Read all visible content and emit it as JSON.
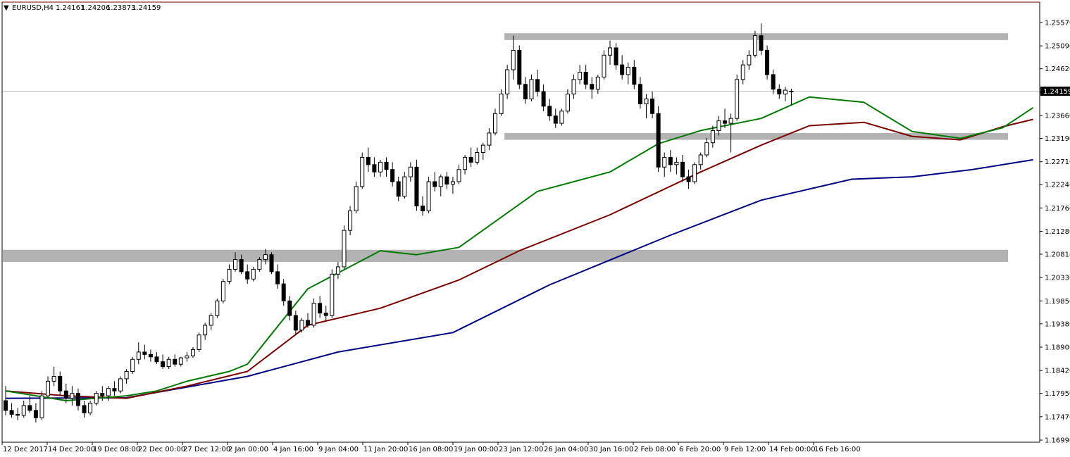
{
  "header": {
    "menu_glyph": "▼",
    "symbol_tf": "EURUSD,H4",
    "ohlc": [
      "1.24161",
      "1.24206",
      "1.23873",
      "1.24159"
    ]
  },
  "colors": {
    "background": "#ffffff",
    "candle": "#000000",
    "ma_fast": "#007a00",
    "ma_mid": "#7a0000",
    "ma_slow": "#000080",
    "zone": "#b3b3b3",
    "price_line": "#c0c0c0",
    "frame_top": "#7a0000"
  },
  "chart_data": {
    "type": "candlestick",
    "instrument": "EURUSD",
    "timeframe": "H4",
    "last_price": "1.24159",
    "y_ticks": [
      "1.25570",
      "1.25090",
      "1.24620",
      "1.24140",
      "1.23660",
      "1.23190",
      "1.22710",
      "1.22240",
      "1.21760",
      "1.21280",
      "1.20810",
      "1.20330",
      "1.19850",
      "1.19380",
      "1.18900",
      "1.18420",
      "1.17950",
      "1.17470",
      "1.16990"
    ],
    "ylim": [
      1.1699,
      1.2557
    ],
    "x_ticks": [
      "12 Dec 2017",
      "14 Dec 20:00",
      "19 Dec 08:00",
      "22 Dec 00:00",
      "27 Dec 12:00",
      "2 Jan 00:00",
      "4 Jan 16:00",
      "9 Jan 04:00",
      "11 Jan 20:00",
      "16 Jan 08:00",
      "19 Jan 00:00",
      "23 Jan 12:00",
      "26 Jan 04:00",
      "30 Jan 16:00",
      "2 Feb 08:00",
      "6 Feb 20:00",
      "9 Feb 12:00",
      "14 Feb 00:00",
      "16 Feb 16:00"
    ],
    "zones": [
      {
        "low": 1.2521,
        "high": 1.2535,
        "from_index": 83,
        "to_index": 179
      },
      {
        "low": 1.2316,
        "high": 1.233,
        "from_index": 83,
        "to_index": 180
      },
      {
        "low": 1.2065,
        "high": 1.209,
        "from_index": 0,
        "to_index": 205
      }
    ],
    "ma_fast": [
      [
        0,
        1.18
      ],
      [
        10,
        1.178
      ],
      [
        20,
        1.179
      ],
      [
        25,
        1.18
      ],
      [
        30,
        1.182
      ],
      [
        37,
        1.184
      ],
      [
        40,
        1.1855
      ],
      [
        50,
        1.201
      ],
      [
        62,
        1.2088
      ],
      [
        68,
        1.208
      ],
      [
        75,
        1.2095
      ],
      [
        88,
        1.221
      ],
      [
        100,
        1.225
      ],
      [
        108,
        1.2308
      ],
      [
        115,
        1.2335
      ],
      [
        125,
        1.236
      ],
      [
        133,
        1.2404
      ],
      [
        142,
        1.2393
      ],
      [
        150,
        1.2333
      ],
      [
        158,
        1.2319
      ],
      [
        165,
        1.2341
      ],
      [
        170,
        1.2382
      ]
    ],
    "ma_mid": [
      [
        0,
        1.18
      ],
      [
        10,
        1.179
      ],
      [
        20,
        1.1785
      ],
      [
        30,
        1.181
      ],
      [
        40,
        1.184
      ],
      [
        50,
        1.1935
      ],
      [
        62,
        1.197
      ],
      [
        75,
        1.2028
      ],
      [
        85,
        1.2088
      ],
      [
        100,
        1.2162
      ],
      [
        115,
        1.225
      ],
      [
        125,
        1.2305
      ],
      [
        133,
        1.2345
      ],
      [
        142,
        1.2352
      ],
      [
        150,
        1.2323
      ],
      [
        158,
        1.2316
      ],
      [
        165,
        1.2343
      ],
      [
        170,
        1.2358
      ]
    ],
    "ma_slow": [
      [
        0,
        1.1785
      ],
      [
        20,
        1.1786
      ],
      [
        40,
        1.183
      ],
      [
        55,
        1.188
      ],
      [
        74,
        1.192
      ],
      [
        90,
        1.2018
      ],
      [
        110,
        1.212
      ],
      [
        125,
        1.2192
      ],
      [
        140,
        1.2235
      ],
      [
        150,
        1.224
      ],
      [
        160,
        1.2255
      ],
      [
        170,
        1.2275
      ]
    ],
    "candles": [
      [
        1.178,
        1.181,
        1.175,
        1.176
      ],
      [
        1.176,
        1.1775,
        1.1745,
        1.1752
      ],
      [
        1.1752,
        1.1765,
        1.174,
        1.175
      ],
      [
        1.175,
        1.178,
        1.1745,
        1.177
      ],
      [
        1.177,
        1.179,
        1.1755,
        1.176
      ],
      [
        1.176,
        1.1775,
        1.1735,
        1.1745
      ],
      [
        1.1745,
        1.18,
        1.174,
        1.179
      ],
      [
        1.179,
        1.183,
        1.1785,
        1.182
      ],
      [
        1.182,
        1.185,
        1.181,
        1.183
      ],
      [
        1.183,
        1.184,
        1.179,
        1.18
      ],
      [
        1.18,
        1.1815,
        1.1775,
        1.1785
      ],
      [
        1.1785,
        1.181,
        1.177,
        1.1795
      ],
      [
        1.1795,
        1.1805,
        1.176,
        1.177
      ],
      [
        1.177,
        1.178,
        1.1745,
        1.1755
      ],
      [
        1.1755,
        1.178,
        1.175,
        1.1775
      ],
      [
        1.1775,
        1.18,
        1.177,
        1.1795
      ],
      [
        1.1795,
        1.181,
        1.178,
        1.179
      ],
      [
        1.179,
        1.181,
        1.178,
        1.1805
      ],
      [
        1.1805,
        1.182,
        1.179,
        1.18
      ],
      [
        1.18,
        1.183,
        1.1795,
        1.1825
      ],
      [
        1.1825,
        1.1845,
        1.1815,
        1.184
      ],
      [
        1.184,
        1.187,
        1.1835,
        1.1865
      ],
      [
        1.1865,
        1.19,
        1.1855,
        1.188
      ],
      [
        1.188,
        1.1895,
        1.1865,
        1.1875
      ],
      [
        1.1875,
        1.1885,
        1.186,
        1.187
      ],
      [
        1.187,
        1.188,
        1.1855,
        1.186
      ],
      [
        1.186,
        1.1875,
        1.1845,
        1.185
      ],
      [
        1.185,
        1.187,
        1.1845,
        1.1865
      ],
      [
        1.1865,
        1.1875,
        1.185,
        1.1855
      ],
      [
        1.1855,
        1.187,
        1.185,
        1.1868
      ],
      [
        1.1868,
        1.188,
        1.186,
        1.1872
      ],
      [
        1.1872,
        1.189,
        1.1868,
        1.1885
      ],
      [
        1.1885,
        1.192,
        1.188,
        1.1915
      ],
      [
        1.1915,
        1.194,
        1.1905,
        1.1935
      ],
      [
        1.1935,
        1.196,
        1.1925,
        1.1955
      ],
      [
        1.1955,
        1.199,
        1.195,
        1.1985
      ],
      [
        1.1985,
        1.203,
        1.198,
        1.2025
      ],
      [
        1.2025,
        1.206,
        1.202,
        1.205
      ],
      [
        1.205,
        1.2085,
        1.2045,
        1.207
      ],
      [
        1.207,
        1.208,
        1.204,
        1.2045
      ],
      [
        1.2045,
        1.206,
        1.202,
        1.203
      ],
      [
        1.203,
        1.2055,
        1.2025,
        1.205
      ],
      [
        1.205,
        1.2075,
        1.2045,
        1.207
      ],
      [
        1.207,
        1.2092,
        1.206,
        1.208
      ],
      [
        1.208,
        1.2085,
        1.204,
        1.2045
      ],
      [
        1.2045,
        1.206,
        1.201,
        1.202
      ],
      [
        1.202,
        1.203,
        1.1975,
        1.1985
      ],
      [
        1.1985,
        1.1995,
        1.1945,
        1.1955
      ],
      [
        1.1955,
        1.1965,
        1.1915,
        1.1925
      ],
      [
        1.1925,
        1.195,
        1.192,
        1.1945
      ],
      [
        1.1945,
        1.196,
        1.193,
        1.1935
      ],
      [
        1.1935,
        1.199,
        1.193,
        1.198
      ],
      [
        1.198,
        1.1995,
        1.195,
        1.196
      ],
      [
        1.196,
        1.1975,
        1.1945,
        1.1955
      ],
      [
        1.1955,
        1.205,
        1.195,
        1.204
      ],
      [
        1.204,
        1.2065,
        1.203,
        1.2055
      ],
      [
        1.2055,
        1.214,
        1.205,
        1.213
      ],
      [
        1.213,
        1.218,
        1.212,
        1.217
      ],
      [
        1.217,
        1.223,
        1.2165,
        1.222
      ],
      [
        1.222,
        1.229,
        1.2215,
        1.228
      ],
      [
        1.228,
        1.23,
        1.225,
        1.2265
      ],
      [
        1.2265,
        1.228,
        1.224,
        1.225
      ],
      [
        1.225,
        1.2275,
        1.224,
        1.227
      ],
      [
        1.227,
        1.228,
        1.224,
        1.2255
      ],
      [
        1.2255,
        1.227,
        1.222,
        1.223
      ],
      [
        1.223,
        1.224,
        1.219,
        1.22
      ],
      [
        1.22,
        1.225,
        1.2195,
        1.224
      ],
      [
        1.224,
        1.227,
        1.223,
        1.226
      ],
      [
        1.226,
        1.2275,
        1.217,
        1.218
      ],
      [
        1.218,
        1.22,
        1.216,
        1.217
      ],
      [
        1.217,
        1.224,
        1.2165,
        1.223
      ],
      [
        1.223,
        1.225,
        1.221,
        1.222
      ],
      [
        1.222,
        1.2245,
        1.22,
        1.224
      ],
      [
        1.224,
        1.225,
        1.2215,
        1.2225
      ],
      [
        1.2225,
        1.224,
        1.2205,
        1.223
      ],
      [
        1.223,
        1.2265,
        1.2225,
        1.2255
      ],
      [
        1.2255,
        1.2285,
        1.2245,
        1.228
      ],
      [
        1.228,
        1.23,
        1.226,
        1.227
      ],
      [
        1.227,
        1.23,
        1.2265,
        1.229
      ],
      [
        1.229,
        1.231,
        1.2275,
        1.2305
      ],
      [
        1.2305,
        1.234,
        1.2295,
        1.233
      ],
      [
        1.233,
        1.238,
        1.2325,
        1.237
      ],
      [
        1.237,
        1.242,
        1.2365,
        1.241
      ],
      [
        1.241,
        1.247,
        1.24,
        1.246
      ],
      [
        1.246,
        1.253,
        1.244,
        1.25
      ],
      [
        1.25,
        1.251,
        1.242,
        1.243
      ],
      [
        1.243,
        1.2445,
        1.239,
        1.24
      ],
      [
        1.24,
        1.245,
        1.2395,
        1.244
      ],
      [
        1.244,
        1.246,
        1.2405,
        1.2415
      ],
      [
        1.2415,
        1.243,
        1.2375,
        1.2385
      ],
      [
        1.2385,
        1.24,
        1.2355,
        1.2365
      ],
      [
        1.2365,
        1.238,
        1.234,
        1.235
      ],
      [
        1.235,
        1.238,
        1.2345,
        1.2375
      ],
      [
        1.2375,
        1.242,
        1.237,
        1.241
      ],
      [
        1.241,
        1.245,
        1.24,
        1.244
      ],
      [
        1.244,
        1.247,
        1.243,
        1.2455
      ],
      [
        1.2455,
        1.247,
        1.242,
        1.243
      ],
      [
        1.243,
        1.2445,
        1.24,
        1.242
      ],
      [
        1.242,
        1.245,
        1.241,
        1.2445
      ],
      [
        1.2445,
        1.25,
        1.244,
        1.249
      ],
      [
        1.249,
        1.252,
        1.247,
        1.2505
      ],
      [
        1.2505,
        1.2515,
        1.246,
        1.247
      ],
      [
        1.247,
        1.249,
        1.244,
        1.245
      ],
      [
        1.245,
        1.2475,
        1.243,
        1.2465
      ],
      [
        1.2465,
        1.248,
        1.242,
        1.243
      ],
      [
        1.243,
        1.2445,
        1.238,
        1.239
      ],
      [
        1.239,
        1.241,
        1.236,
        1.24
      ],
      [
        1.24,
        1.2415,
        1.236,
        1.237
      ],
      [
        1.237,
        1.2385,
        1.225,
        1.226
      ],
      [
        1.226,
        1.229,
        1.224,
        1.228
      ],
      [
        1.228,
        1.2295,
        1.225,
        1.2265
      ],
      [
        1.2265,
        1.228,
        1.2245,
        1.227
      ],
      [
        1.227,
        1.2285,
        1.223,
        1.224
      ],
      [
        1.224,
        1.2255,
        1.2215,
        1.223
      ],
      [
        1.223,
        1.227,
        1.2225,
        1.2265
      ],
      [
        1.2265,
        1.229,
        1.2255,
        1.2285
      ],
      [
        1.2285,
        1.232,
        1.228,
        1.231
      ],
      [
        1.231,
        1.2345,
        1.23,
        1.2335
      ],
      [
        1.2335,
        1.2365,
        1.2325,
        1.2355
      ],
      [
        1.2355,
        1.238,
        1.234,
        1.235
      ],
      [
        1.235,
        1.237,
        1.229,
        1.236
      ],
      [
        1.236,
        1.245,
        1.2355,
        1.244
      ],
      [
        1.244,
        1.248,
        1.243,
        1.247
      ],
      [
        1.247,
        1.25,
        1.246,
        1.249
      ],
      [
        1.249,
        1.254,
        1.2485,
        1.253
      ],
      [
        1.253,
        1.2555,
        1.249,
        1.25
      ],
      [
        1.25,
        1.251,
        1.244,
        1.245
      ],
      [
        1.245,
        1.246,
        1.241,
        1.242
      ],
      [
        1.242,
        1.243,
        1.24,
        1.241
      ],
      [
        1.241,
        1.2425,
        1.2395,
        1.2418
      ],
      [
        1.2416,
        1.2421,
        1.2387,
        1.2416
      ]
    ]
  }
}
